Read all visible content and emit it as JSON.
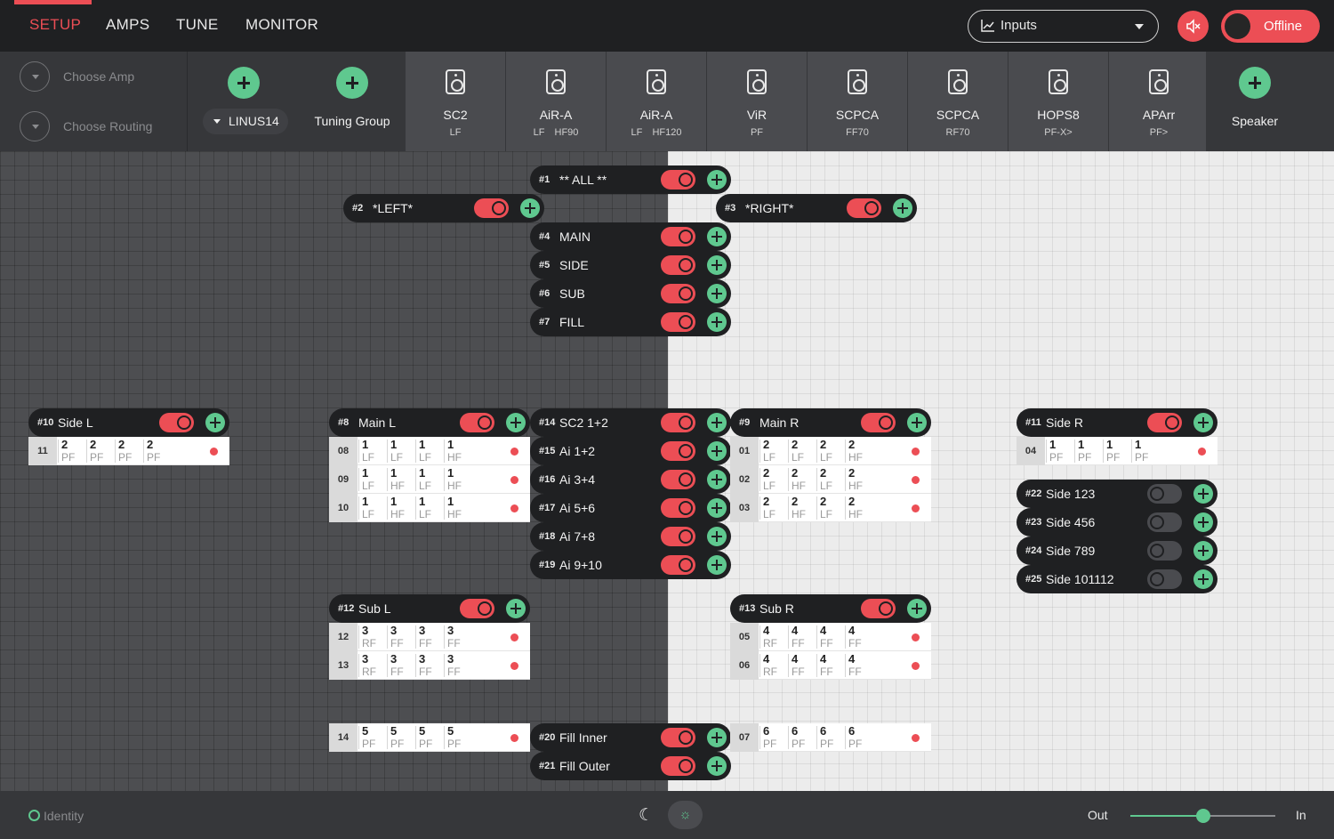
{
  "tabs": [
    {
      "label": "SETUP",
      "active": true
    },
    {
      "label": "AMPS",
      "active": false
    },
    {
      "label": "TUNE",
      "active": false
    },
    {
      "label": "MONITOR",
      "active": false
    }
  ],
  "view_select": {
    "value": "Inputs",
    "icon": "chart-icon"
  },
  "mute": {
    "icon": "speaker-mute-icon",
    "active": true
  },
  "connection": {
    "label": "Offline",
    "on": false
  },
  "choose": {
    "amp": "Choose Amp",
    "routing": "Choose Routing"
  },
  "linus": "LINUS14",
  "tuning_group": "Tuning Group",
  "speaker_add": "Speaker",
  "devices": [
    {
      "name": "SC2",
      "sub": [
        "LF"
      ]
    },
    {
      "name": "AiR-A",
      "sub": [
        "LF",
        "HF90"
      ]
    },
    {
      "name": "AiR-A",
      "sub": [
        "LF",
        "HF120"
      ]
    },
    {
      "name": "ViR",
      "sub": [
        "PF"
      ]
    },
    {
      "name": "SCPCA",
      "sub": [
        "FF70"
      ]
    },
    {
      "name": "SCPCA",
      "sub": [
        "RF70"
      ]
    },
    {
      "name": "HOPS8",
      "sub": [
        "PF-X>"
      ]
    },
    {
      "name": "APArr",
      "sub": [
        "PF>"
      ]
    }
  ],
  "groups": [
    {
      "id": "#1",
      "name": "** ALL **",
      "on": true
    },
    {
      "id": "#2",
      "name": "*LEFT*",
      "on": true
    },
    {
      "id": "#3",
      "name": "*RIGHT*",
      "on": true
    },
    {
      "id": "#4",
      "name": "MAIN",
      "on": true
    },
    {
      "id": "#5",
      "name": "SIDE",
      "on": true
    },
    {
      "id": "#6",
      "name": "SUB",
      "on": true
    },
    {
      "id": "#7",
      "name": "FILL",
      "on": true
    },
    {
      "id": "#10",
      "name": "Side L",
      "on": true
    },
    {
      "id": "#8",
      "name": "Main L",
      "on": true
    },
    {
      "id": "#14",
      "name": "SC2 1+2",
      "on": true
    },
    {
      "id": "#9",
      "name": "Main R",
      "on": true
    },
    {
      "id": "#11",
      "name": "Side R",
      "on": true
    },
    {
      "id": "#15",
      "name": "Ai 1+2",
      "on": true
    },
    {
      "id": "#16",
      "name": "Ai 3+4",
      "on": true
    },
    {
      "id": "#17",
      "name": "Ai 5+6",
      "on": true
    },
    {
      "id": "#18",
      "name": "Ai 7+8",
      "on": true
    },
    {
      "id": "#19",
      "name": "Ai 9+10",
      "on": true
    },
    {
      "id": "#22",
      "name": "Side 123",
      "on": false
    },
    {
      "id": "#23",
      "name": "Side 456",
      "on": false
    },
    {
      "id": "#24",
      "name": "Side 789",
      "on": false
    },
    {
      "id": "#25",
      "name": "Side 101112",
      "on": false
    },
    {
      "id": "#12",
      "name": "Sub L",
      "on": true
    },
    {
      "id": "#13",
      "name": "Sub R",
      "on": true
    },
    {
      "id": "#20",
      "name": "Fill Inner",
      "on": true
    },
    {
      "id": "#21",
      "name": "Fill Outer",
      "on": true
    }
  ],
  "amps": [
    {
      "id": "11",
      "ch": [
        [
          "2",
          "PF"
        ],
        [
          "2",
          "PF"
        ],
        [
          "2",
          "PF"
        ],
        [
          "2",
          "PF"
        ]
      ]
    },
    {
      "id": "08",
      "ch": [
        [
          "1",
          "LF"
        ],
        [
          "1",
          "LF"
        ],
        [
          "1",
          "LF"
        ],
        [
          "1",
          "HF"
        ]
      ]
    },
    {
      "id": "09",
      "ch": [
        [
          "1",
          "LF"
        ],
        [
          "1",
          "HF"
        ],
        [
          "1",
          "LF"
        ],
        [
          "1",
          "HF"
        ]
      ]
    },
    {
      "id": "10",
      "ch": [
        [
          "1",
          "LF"
        ],
        [
          "1",
          "HF"
        ],
        [
          "1",
          "LF"
        ],
        [
          "1",
          "HF"
        ]
      ]
    },
    {
      "id": "01",
      "ch": [
        [
          "2",
          "LF"
        ],
        [
          "2",
          "LF"
        ],
        [
          "2",
          "LF"
        ],
        [
          "2",
          "HF"
        ]
      ]
    },
    {
      "id": "02",
      "ch": [
        [
          "2",
          "LF"
        ],
        [
          "2",
          "HF"
        ],
        [
          "2",
          "LF"
        ],
        [
          "2",
          "HF"
        ]
      ]
    },
    {
      "id": "03",
      "ch": [
        [
          "2",
          "LF"
        ],
        [
          "2",
          "HF"
        ],
        [
          "2",
          "LF"
        ],
        [
          "2",
          "HF"
        ]
      ]
    },
    {
      "id": "04",
      "ch": [
        [
          "1",
          "PF"
        ],
        [
          "1",
          "PF"
        ],
        [
          "1",
          "PF"
        ],
        [
          "1",
          "PF"
        ]
      ]
    },
    {
      "id": "12",
      "ch": [
        [
          "3",
          "RF"
        ],
        [
          "3",
          "FF"
        ],
        [
          "3",
          "FF"
        ],
        [
          "3",
          "FF"
        ]
      ]
    },
    {
      "id": "13",
      "ch": [
        [
          "3",
          "RF"
        ],
        [
          "3",
          "FF"
        ],
        [
          "3",
          "FF"
        ],
        [
          "3",
          "FF"
        ]
      ]
    },
    {
      "id": "05",
      "ch": [
        [
          "4",
          "RF"
        ],
        [
          "4",
          "FF"
        ],
        [
          "4",
          "FF"
        ],
        [
          "4",
          "FF"
        ]
      ]
    },
    {
      "id": "06",
      "ch": [
        [
          "4",
          "RF"
        ],
        [
          "4",
          "FF"
        ],
        [
          "4",
          "FF"
        ],
        [
          "4",
          "FF"
        ]
      ]
    },
    {
      "id": "14",
      "ch": [
        [
          "5",
          "PF"
        ],
        [
          "5",
          "PF"
        ],
        [
          "5",
          "PF"
        ],
        [
          "5",
          "PF"
        ]
      ]
    },
    {
      "id": "07",
      "ch": [
        [
          "6",
          "PF"
        ],
        [
          "6",
          "PF"
        ],
        [
          "6",
          "PF"
        ],
        [
          "6",
          "PF"
        ]
      ]
    }
  ],
  "footer": {
    "identity": "Identity",
    "out": "Out",
    "in": "In",
    "balance": 0.5,
    "moon_icon": "☾",
    "sun_icon": "☼"
  },
  "colors": {
    "accent_red": "#ec4e55",
    "accent_green": "#5fc88f"
  }
}
